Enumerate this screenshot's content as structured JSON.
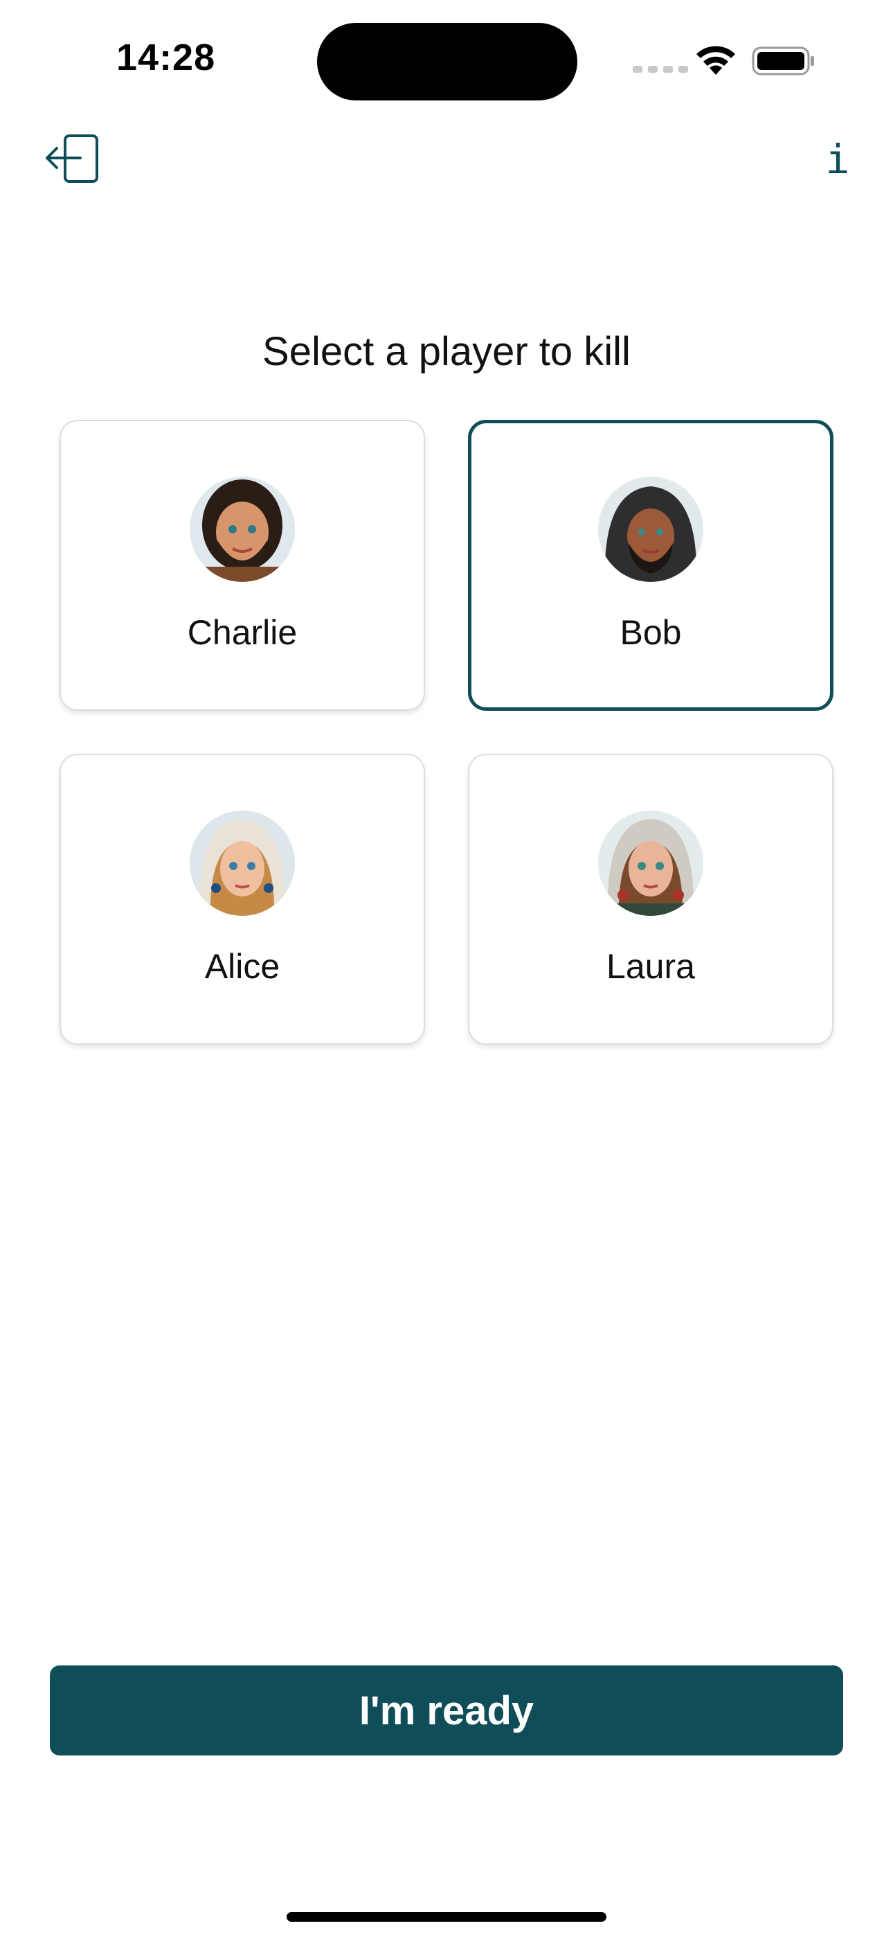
{
  "status_bar": {
    "time": "14:28"
  },
  "nav": {
    "exit_icon": "exit-door-icon",
    "info_label": "i"
  },
  "title": "Select a player to kill",
  "players": [
    {
      "name": "Charlie",
      "avatar": "bearded-man-avatar",
      "selected": false
    },
    {
      "name": "Bob",
      "avatar": "hooded-man-avatar",
      "selected": true
    },
    {
      "name": "Alice",
      "avatar": "blonde-woman-headscarf-avatar",
      "selected": false
    },
    {
      "name": "Laura",
      "avatar": "woman-headscarf-avatar",
      "selected": false
    }
  ],
  "ready_button": "I'm ready",
  "colors": {
    "accent": "#0f4d58",
    "card_border": "#dcdcdc",
    "background": "#ffffff"
  }
}
